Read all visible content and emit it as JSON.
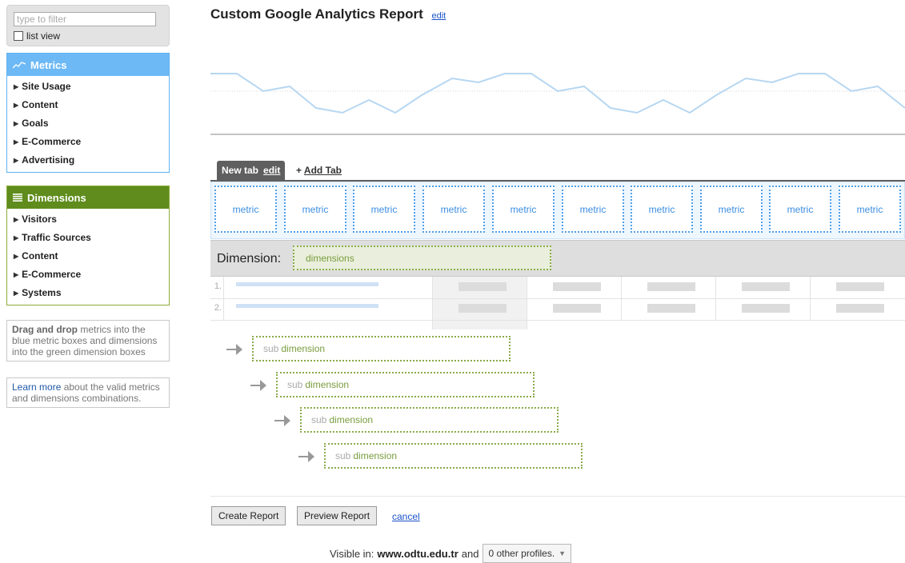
{
  "sidebar": {
    "filter_placeholder": "type to filter",
    "list_view_label": "list view",
    "metrics": {
      "title": "Metrics",
      "items": [
        {
          "label": "Site Usage"
        },
        {
          "label": "Content"
        },
        {
          "label": "Goals"
        },
        {
          "label": "E-Commerce"
        },
        {
          "label": "Advertising"
        }
      ]
    },
    "dimensions": {
      "title": "Dimensions",
      "items": [
        {
          "label": "Visitors"
        },
        {
          "label": "Traffic Sources"
        },
        {
          "label": "Content"
        },
        {
          "label": "E-Commerce"
        },
        {
          "label": "Systems"
        }
      ]
    },
    "help_box": {
      "bold": "Drag and drop",
      "text": " metrics into the blue metric boxes and dimensions into the green dimension boxes"
    },
    "learn_box": {
      "link": "Learn more",
      "text": " about the valid metrics and dimensions combinations."
    }
  },
  "header": {
    "title": "Custom Google Analytics Report",
    "edit_link": "edit"
  },
  "tabs": {
    "active_label": "New tab",
    "active_edit": "edit",
    "add_tab": "Add Tab"
  },
  "metric_boxes": [
    {
      "label": "metric"
    },
    {
      "label": "metric"
    },
    {
      "label": "metric"
    },
    {
      "label": "metric"
    },
    {
      "label": "metric"
    },
    {
      "label": "metric"
    },
    {
      "label": "metric"
    },
    {
      "label": "metric"
    },
    {
      "label": "metric"
    },
    {
      "label": "metric"
    }
  ],
  "dimension": {
    "label": "Dimension:",
    "placeholder": "dimensions"
  },
  "table_rows": [
    {
      "num": "1."
    },
    {
      "num": "2."
    }
  ],
  "sub_dimensions": [
    {
      "prefix": "sub",
      "word": "dimension"
    },
    {
      "prefix": "sub",
      "word": "dimension"
    },
    {
      "prefix": "sub",
      "word": "dimension"
    },
    {
      "prefix": "sub",
      "word": "dimension"
    }
  ],
  "actions": {
    "create": "Create Report",
    "preview": "Preview Report",
    "cancel": "cancel"
  },
  "visibility": {
    "prefix": "Visible in:",
    "site": "www.odtu.edu.tr",
    "and": "and",
    "profiles": "0 other profiles."
  },
  "colors": {
    "metrics_accent": "#6db9f6",
    "dimensions_accent": "#5f8c1c",
    "metric_border": "#4f9fe6",
    "dimension_border": "#8aab4a",
    "sparkline": "#b7d7f2"
  }
}
